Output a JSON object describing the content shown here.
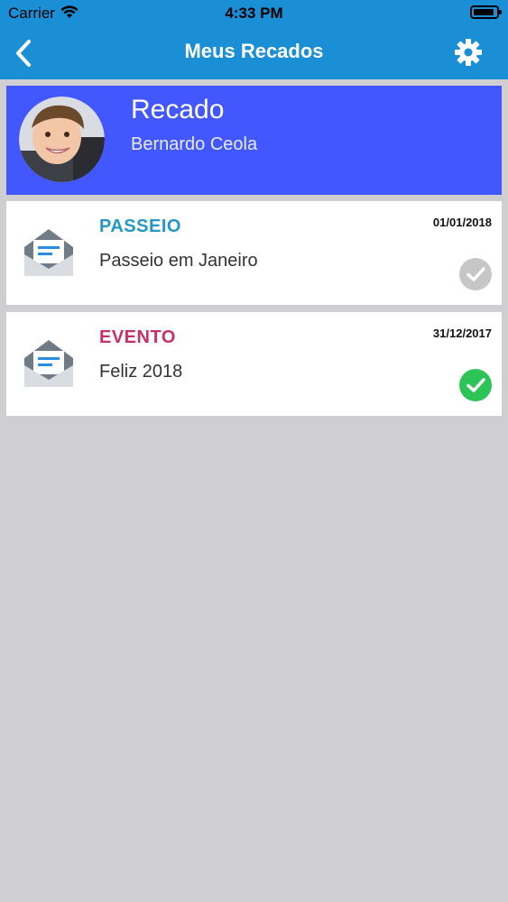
{
  "status_bar": {
    "carrier": "Carrier",
    "time": "4:33 PM"
  },
  "nav": {
    "title": "Meus Recados"
  },
  "profile": {
    "title": "Recado",
    "name": "Bernardo Ceola"
  },
  "messages": [
    {
      "category": "PASSEIO",
      "category_color": "#2596c8",
      "subject": "Passeio em Janeiro",
      "date": "01/01/2018",
      "read_status": "unconfirmed"
    },
    {
      "category": "EVENTO",
      "category_color": "#c8306a",
      "subject": "Feliz 2018",
      "date": "31/12/2017",
      "read_status": "confirmed"
    }
  ],
  "icons": {
    "back": "chevron-left-icon",
    "settings": "gear-icon",
    "envelope": "open-envelope-icon",
    "check_unconfirmed": "gray-check-circle-icon",
    "check_confirmed": "green-check-circle-icon"
  },
  "colors": {
    "header": "#1a8fd6",
    "profile_banner": "#4257fe",
    "background": "#cfcfd1",
    "check_green": "#2dc457",
    "check_gray": "#c6c6c6"
  }
}
